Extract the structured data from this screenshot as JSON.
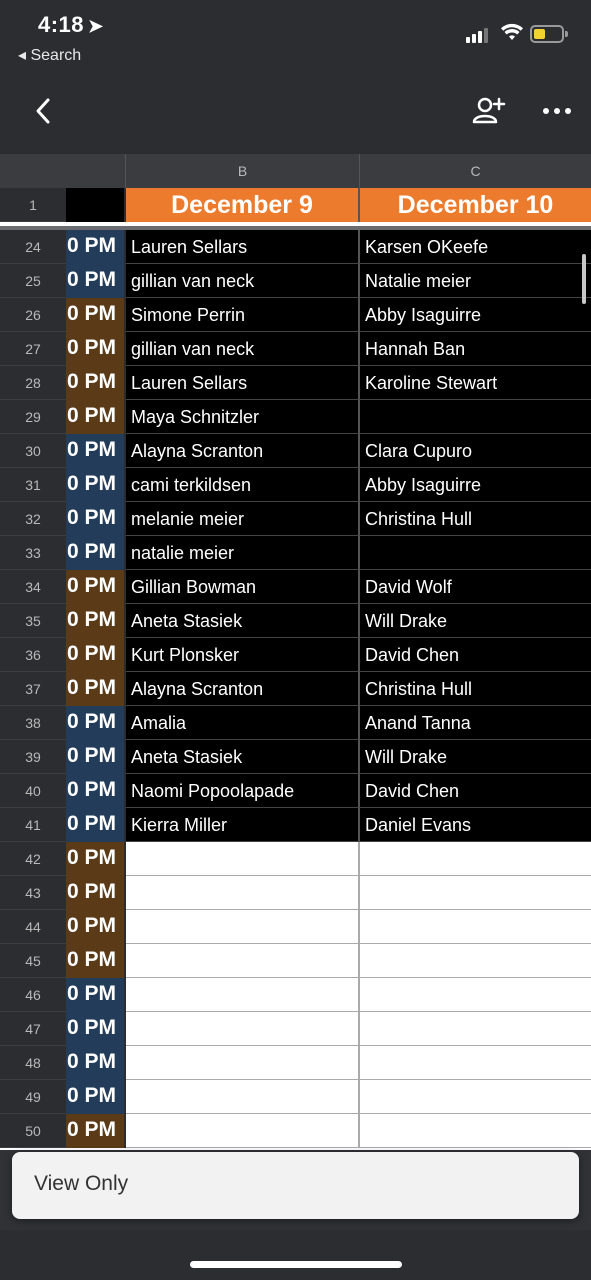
{
  "status": {
    "time": "4:18",
    "back_app": "Search"
  },
  "nav": {},
  "columns": {
    "b": "B",
    "c": "C"
  },
  "header_row": {
    "num": "1",
    "b": "December 9",
    "c": "December 10"
  },
  "time_label": "0 PM",
  "rows": [
    {
      "num": "24",
      "b": "Lauren Sellars",
      "c": "Karsen OKeefe",
      "tone": "blue"
    },
    {
      "num": "25",
      "b": "gillian van neck",
      "c": "Natalie meier",
      "tone": "blue"
    },
    {
      "num": "26",
      "b": "Simone Perrin",
      "c": "Abby Isaguirre",
      "tone": "brown"
    },
    {
      "num": "27",
      "b": "gillian van neck",
      "c": "Hannah Ban",
      "tone": "brown"
    },
    {
      "num": "28",
      "b": "Lauren Sellars",
      "c": "Karoline Stewart",
      "tone": "brown"
    },
    {
      "num": "29",
      "b": "Maya Schnitzler",
      "c": "",
      "tone": "brown"
    },
    {
      "num": "30",
      "b": "Alayna Scranton",
      "c": "Clara Cupuro",
      "tone": "blue"
    },
    {
      "num": "31",
      "b": "cami terkildsen",
      "c": "Abby Isaguirre",
      "tone": "blue"
    },
    {
      "num": "32",
      "b": "melanie meier",
      "c": "Christina Hull",
      "tone": "blue"
    },
    {
      "num": "33",
      "b": "natalie meier",
      "c": "",
      "tone": "blue"
    },
    {
      "num": "34",
      "b": "Gillian Bowman",
      "c": "David Wolf",
      "tone": "brown"
    },
    {
      "num": "35",
      "b": "Aneta Stasiek",
      "c": "Will Drake",
      "tone": "brown"
    },
    {
      "num": "36",
      "b": "Kurt Plonsker",
      "c": "David Chen",
      "tone": "brown"
    },
    {
      "num": "37",
      "b": "Alayna Scranton",
      "c": "Christina Hull",
      "tone": "brown"
    },
    {
      "num": "38",
      "b": "Amalia",
      "c": "Anand Tanna",
      "tone": "blue"
    },
    {
      "num": "39",
      "b": "Aneta Stasiek",
      "c": "Will Drake",
      "tone": "blue"
    },
    {
      "num": "40",
      "b": "Naomi Popoolapade",
      "c": "David Chen",
      "tone": "blue"
    },
    {
      "num": "41",
      "b": "Kierra Miller",
      "c": "Daniel Evans",
      "tone": "blue"
    },
    {
      "num": "42",
      "b": "",
      "c": "",
      "tone": "brown"
    },
    {
      "num": "43",
      "b": "",
      "c": "",
      "tone": "brown"
    },
    {
      "num": "44",
      "b": "",
      "c": "",
      "tone": "brown"
    },
    {
      "num": "45",
      "b": "",
      "c": "",
      "tone": "brown"
    },
    {
      "num": "46",
      "b": "",
      "c": "",
      "tone": "blue"
    },
    {
      "num": "47",
      "b": "",
      "c": "",
      "tone": "blue"
    },
    {
      "num": "48",
      "b": "",
      "c": "",
      "tone": "blue"
    },
    {
      "num": "49",
      "b": "",
      "c": "",
      "tone": "blue"
    },
    {
      "num": "50",
      "b": "",
      "c": "",
      "tone": "brown"
    }
  ],
  "toast": {
    "text": "View Only"
  },
  "colors": {
    "header_orange": "#ec7b2e",
    "time_blue": "#223c5a",
    "time_brown": "#5b3a17",
    "battery": "#f2d22e"
  }
}
